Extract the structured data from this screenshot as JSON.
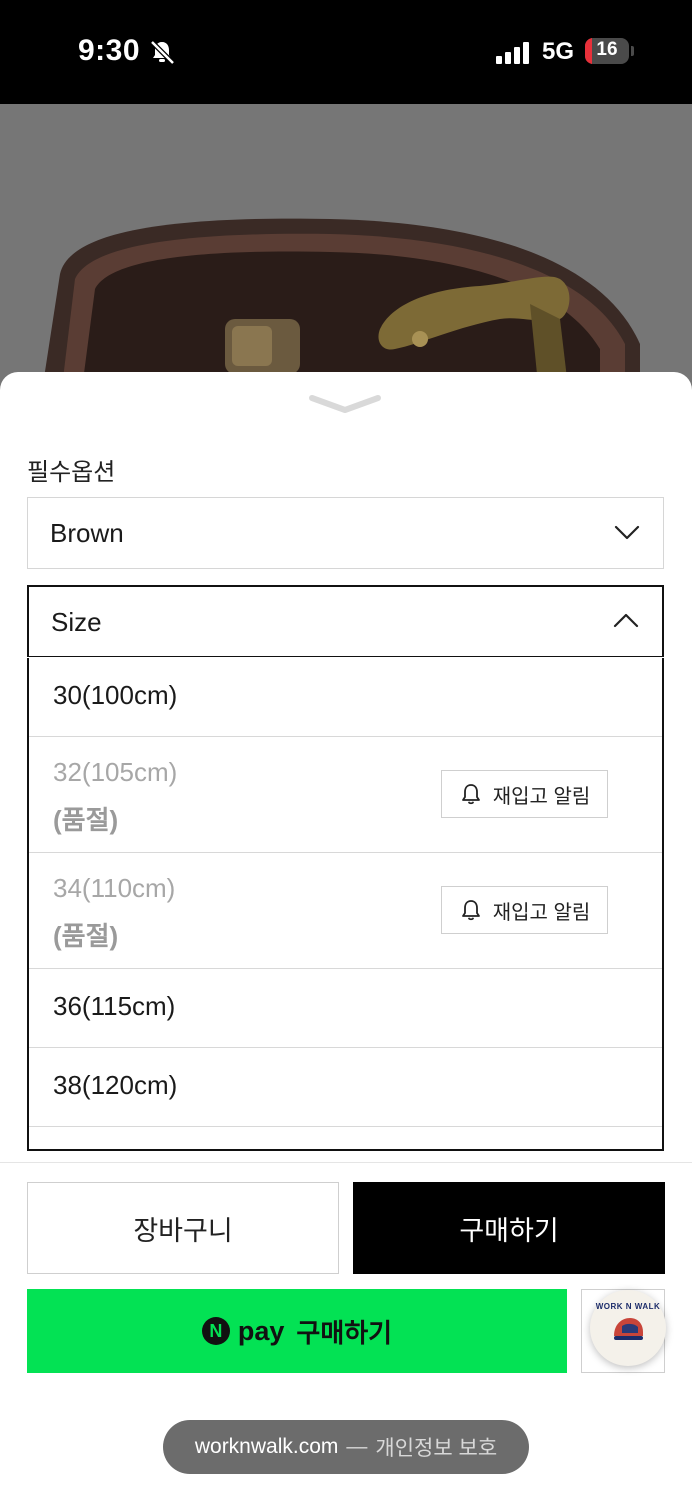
{
  "status_bar": {
    "time": "9:30",
    "network": "5G",
    "battery": "16",
    "battery_level": 0.16,
    "icons": [
      "bell-muted-icon",
      "signal-icon",
      "battery-icon"
    ]
  },
  "sheet": {
    "section_label": "필수옵션",
    "color_select": {
      "value": "Brown",
      "icon": "chevron-down-icon"
    },
    "size_select": {
      "value": "Size",
      "icon": "chevron-up-icon"
    },
    "size_options": [
      {
        "label": "30(100cm)"
      },
      {
        "label": "32(105cm)",
        "soldout": "(품절)",
        "restock": "재입고 알림"
      },
      {
        "label": "34(110cm)",
        "soldout": "(품절)",
        "restock": "재입고 알림"
      },
      {
        "label": "36(115cm)"
      },
      {
        "label": "38(120cm)"
      }
    ]
  },
  "actions": {
    "cart": "장바구니",
    "buy": "구매하기",
    "npay_n": "N",
    "npay_pay": "pay",
    "npay_buy": "구매하기"
  },
  "fab": {
    "brand": "WORK N WALK"
  },
  "url_bar": {
    "domain": "worknwalk.com",
    "separator": "—",
    "privacy": "개인정보 보호"
  },
  "colors": {
    "npay_green": "#03e254",
    "buy_black": "#000000",
    "soldout_gray": "#a7a7a7",
    "battery_red": "#e8303a"
  }
}
